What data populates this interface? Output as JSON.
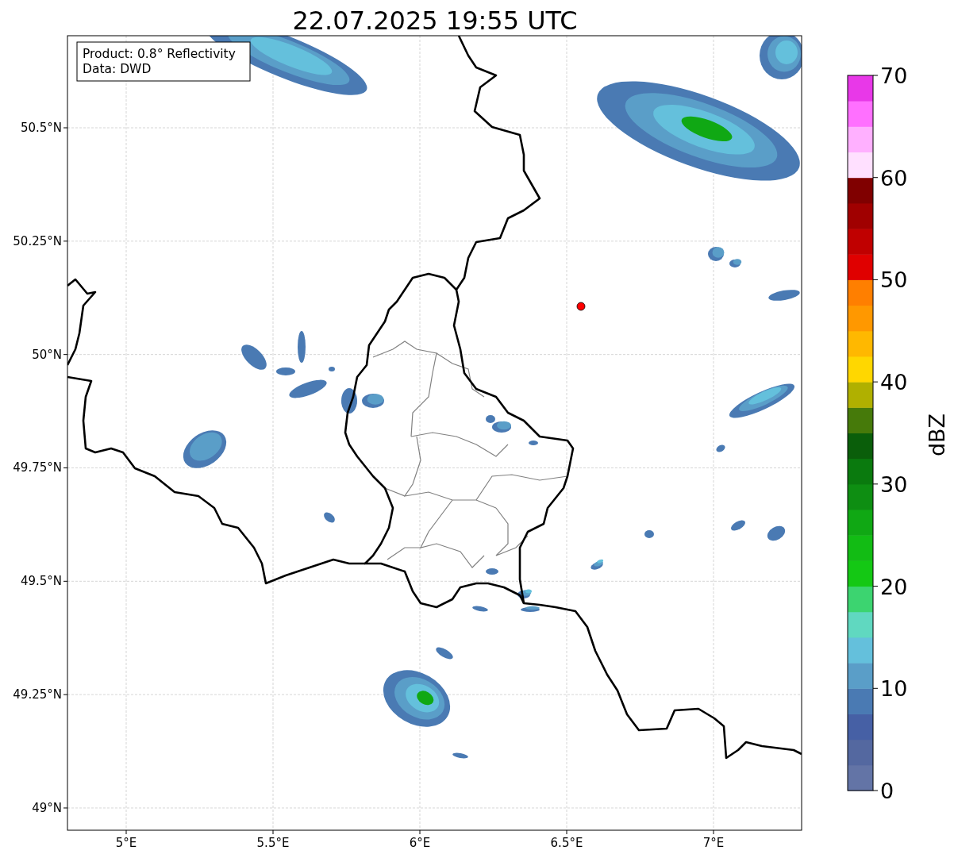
{
  "title": "22.07.2025 19:55 UTC",
  "info_box": {
    "lines": [
      "Product: 0.8° Reflectivity",
      "Data: DWD"
    ]
  },
  "map": {
    "x_ticks": [
      "5°E",
      "5.5°E",
      "6°E",
      "6.5°E",
      "7°E"
    ],
    "y_ticks": [
      "50.5°N",
      "50.25°N",
      "50°N",
      "49.75°N",
      "49.5°N",
      "49.25°N",
      "49°N"
    ]
  },
  "colorbar": {
    "label": "dBZ",
    "ticks": [
      "70",
      "60",
      "50",
      "40",
      "30",
      "20",
      "10",
      "0"
    ],
    "segments": [
      {
        "color": "#6374a6"
      },
      {
        "color": "#5468a0"
      },
      {
        "color": "#4660a5"
      },
      {
        "color": "#4a7ab3"
      },
      {
        "color": "#5a9ec8"
      },
      {
        "color": "#64c0dc"
      },
      {
        "color": "#60d8c0"
      },
      {
        "color": "#3cd470"
      },
      {
        "color": "#14c814"
      },
      {
        "color": "#12bc14"
      },
      {
        "color": "#10a814"
      },
      {
        "color": "#0e8e12"
      },
      {
        "color": "#0a7a0e"
      },
      {
        "color": "#0a5e0a"
      },
      {
        "color": "#467a0a"
      },
      {
        "color": "#b0b000"
      },
      {
        "color": "#ffd700"
      },
      {
        "color": "#ffb800"
      },
      {
        "color": "#ff9800"
      },
      {
        "color": "#ff7f00"
      },
      {
        "color": "#e00000"
      },
      {
        "color": "#c00000"
      },
      {
        "color": "#a00000"
      },
      {
        "color": "#800000"
      },
      {
        "color": "#ffe0ff"
      },
      {
        "color": "#ffb0ff"
      },
      {
        "color": "#ff70ff"
      },
      {
        "color": "#e838e8"
      }
    ]
  }
}
